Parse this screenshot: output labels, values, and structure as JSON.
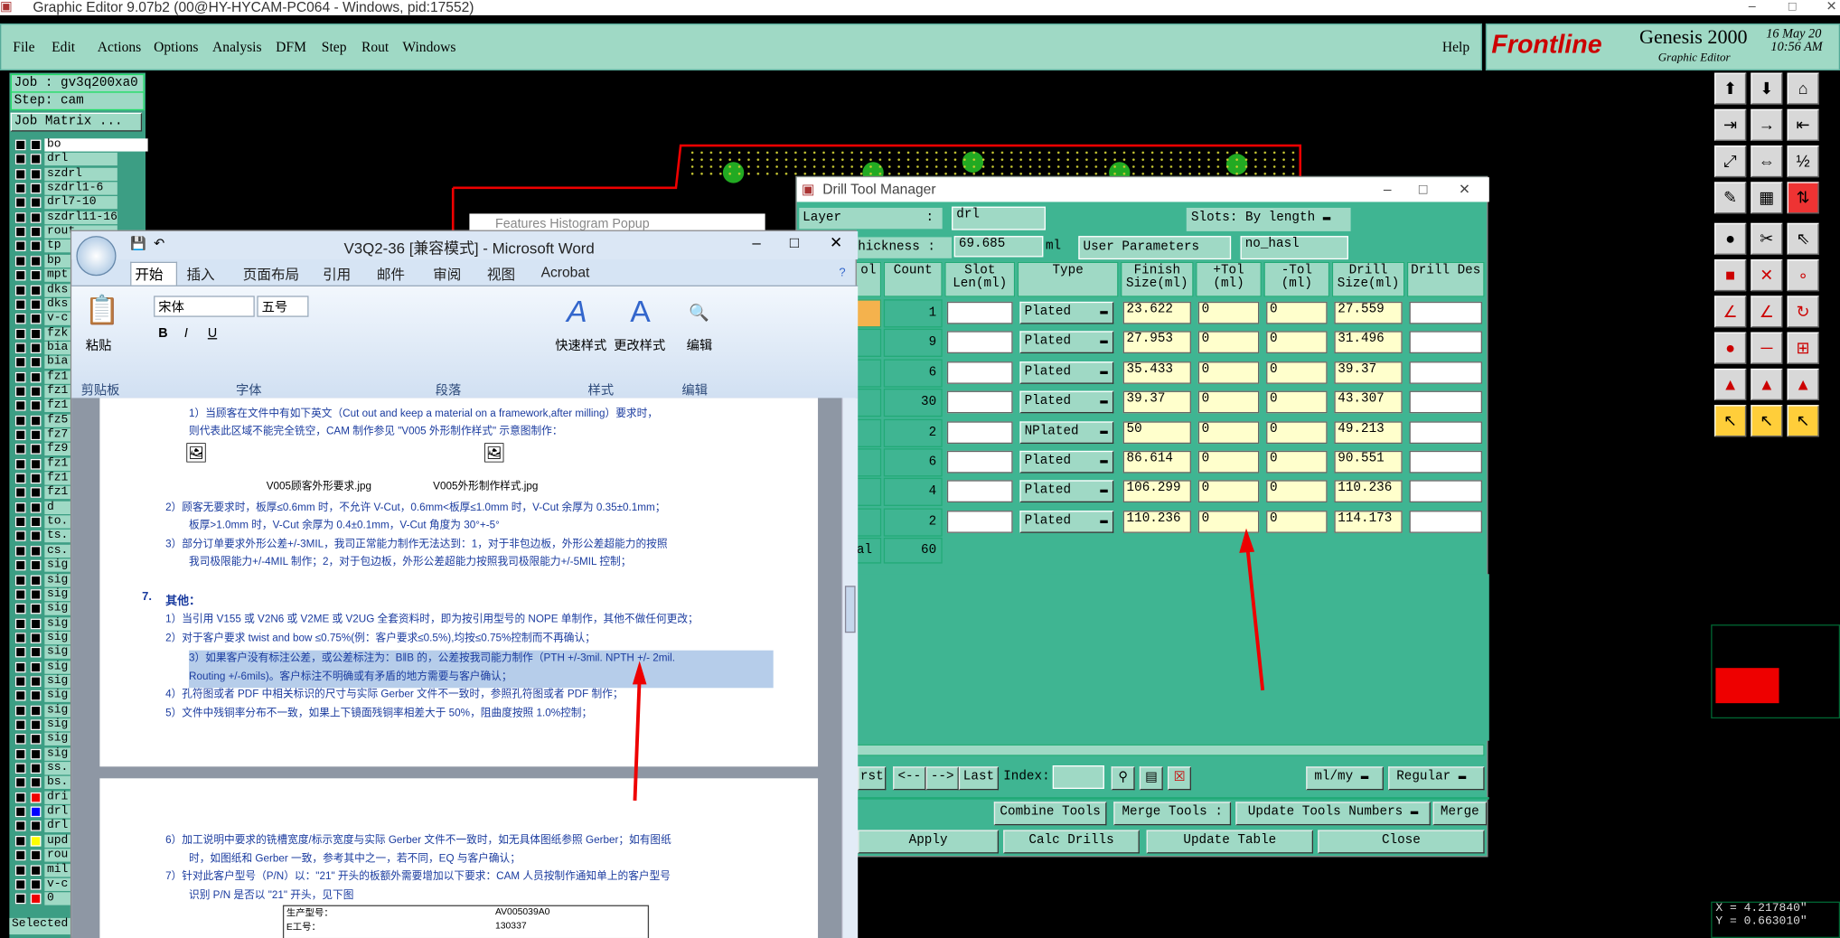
{
  "window": {
    "title": "Graphic Editor 9.07b2 (00@HY-HYCAM-PC064 - Windows, pid:17552)"
  },
  "menu": {
    "items": [
      "File",
      "Edit",
      "Actions",
      "Options",
      "Analysis",
      "DFM",
      "Step",
      "Rout",
      "Windows"
    ],
    "help": "Help"
  },
  "brand": {
    "logo": "Frontline",
    "product": "Genesis 2000",
    "sub": "Graphic Editor",
    "date": "16 May 20",
    "time": "10:56 AM"
  },
  "left": {
    "job": "Job : gv3q200xa0",
    "step": "Step: cam",
    "matrix": "Job Matrix ...",
    "layers": [
      "bo",
      "drl",
      "szdrl",
      "szdrl1-6",
      "drl7-10",
      "szdrl11-16",
      "rout",
      "tp",
      "bp",
      "mpt",
      "dks",
      "dks",
      "v-c",
      "fzk",
      "bia",
      "bia",
      "fz1",
      "fz1",
      "fz1",
      "fz5",
      "fz7",
      "fz9",
      "fz1",
      "fz1",
      "fz1",
      "d",
      "to.",
      "ts.",
      "cs.",
      "sig",
      "sig",
      "sig",
      "sig",
      "sig",
      "sig",
      "sig",
      "sig",
      "sig",
      "sig",
      "sig",
      "sig",
      "sig",
      "sig",
      "ss.",
      "bs.",
      "dri",
      "drl",
      "drl",
      "upd",
      "rou",
      "mil",
      "v-c",
      "0"
    ],
    "selected": "Selected"
  },
  "coords": {
    "x": "X = 4.217840\"",
    "y": "Y = 0.663010\""
  },
  "histogram": {
    "title": "Features Histogram Popup"
  },
  "dtm": {
    "title": "Drill Tool Manager",
    "layer_label": "Layer",
    "layer_value": "drl",
    "slots_label": "Slots:",
    "slots_value": "By length",
    "thickness_label": "hickness :",
    "thickness_value": "69.685",
    "thickness_unit": "ml",
    "user_params_label": "User Parameters",
    "user_params_value": "no_hasl",
    "headers": [
      "ol",
      "Count",
      "Slot Len(ml)",
      "Type",
      "Finish Size(ml)",
      "+Tol (ml)",
      "-Tol (ml)",
      "Drill Size(ml)",
      "Drill Des"
    ],
    "rows": [
      {
        "count": "1",
        "type": "Plated",
        "finish": "23.622",
        "ptol": "0",
        "ntol": "0",
        "drill": "27.559"
      },
      {
        "count": "9",
        "type": "Plated",
        "finish": "27.953",
        "ptol": "0",
        "ntol": "0",
        "drill": "31.496"
      },
      {
        "count": "6",
        "type": "Plated",
        "finish": "35.433",
        "ptol": "0",
        "ntol": "0",
        "drill": "39.37"
      },
      {
        "count": "30",
        "type": "Plated",
        "finish": "39.37",
        "ptol": "0",
        "ntol": "0",
        "drill": "43.307"
      },
      {
        "count": "2",
        "type": "NPlated",
        "finish": "50",
        "ptol": "0",
        "ntol": "0",
        "drill": "49.213"
      },
      {
        "count": "6",
        "type": "Plated",
        "finish": "86.614",
        "ptol": "0",
        "ntol": "0",
        "drill": "90.551"
      },
      {
        "count": "4",
        "type": "Plated",
        "finish": "106.299",
        "ptol": "0",
        "ntol": "0",
        "drill": "110.236"
      },
      {
        "count": "2",
        "type": "Plated",
        "finish": "110.236",
        "ptol": "0",
        "ntol": "0",
        "drill": "114.173"
      }
    ],
    "total_label": "al",
    "total_count": "60",
    "nav": [
      "rst",
      "<--",
      "-->",
      "Last"
    ],
    "index_label": "Index:",
    "units": "ml/my",
    "mode": "Regular",
    "combine": "Combine Tools",
    "merge": "Merge Tools :",
    "update_num": "Update Tools Numbers",
    "merge_btn": "Merge",
    "apply": "Apply",
    "calc": "Calc Drills",
    "update_table": "Update Table",
    "close": "Close"
  },
  "word": {
    "title": "V3Q2-36 [兼容模式] - Microsoft Word",
    "tabs": [
      "开始",
      "插入",
      "页面布局",
      "引用",
      "邮件",
      "审阅",
      "视图",
      "Acrobat"
    ],
    "groups": [
      "剪贴板",
      "字体",
      "段落",
      "样式",
      "编辑"
    ],
    "font": "宋体",
    "size": "五号",
    "paste": "粘贴",
    "quick_style": "快速样式",
    "change_style": "更改样式",
    "edit": "编辑",
    "lines": [
      "1）当顾客在文件中有如下英文（Cut out and keep a material on a framework,after milling）要求时，",
      "则代表此区域不能完全铣空，CAM 制作参见 \"V005 外形制作样式\" 示意图制作：",
      "V005顾客外形要求.jpg",
      "V005外形制作样式.jpg",
      "2）顾客无要求时，板厚≤0.6mm 时，不允许 V-Cut，0.6mm<板厚≤1.0mm 时，V-Cut 余厚为 0.35±0.1mm；",
      "板厚>1.0mm 时，V-Cut 余厚为 0.4±0.1mm，V-Cut 角度为 30°+-5°",
      "3）部分订单要求外形公差+/-3MIL，我司正常能力制作无法达到：1，对于非包边板，外形公差超能力的按照",
      "我司极限能力+/-4MIL 制作；2，对于包边板，外形公差超能力按照我司极限能力+/-5MIL 控制；",
      "7.",
      "其他：",
      "1）当引用 V155 或 V2N6 或 V2ME 或 V2UG 全套资料时，即为按引用型号的 NOPE 单制作，其他不做任何更改；",
      "2）对于客户要求 twist and bow ≤0.75%(例：客户要求≤0.5%),均按≤0.75%控制而不再确认；",
      "3）如果客户没有标注公差，或公差标注为：B‖B 的，公差按我司能力制作（PTH +/-3mil. NPTH +/- 2mil.",
      "Routing +/-6mils)。客户标注不明确或有矛盾的地方需要与客户确认；",
      "4）孔符图或者 PDF 中相关标识的尺寸与实际 Gerber 文件不一致时，参照孔符图或者 PDF 制作；",
      "5）文件中残铜率分布不一致，如果上下镜面残铜率相差大于 50%，阻曲度按照 1.0%控制；",
      "6）加工说明中要求的铣槽宽度/标示宽度与实际 Gerber 文件不一致时，如无具体图纸参照 Gerber；如有图纸",
      "时，如图纸和 Gerber 一致，参考其中之一，若不同，EQ 与客户确认；",
      "7）针对此客户型号（P/N）以：\"21\" 开头的板额外需要增加以下要求：CAM 人员按制作通知单上的客户型号",
      "识别 P/N 是否以 \"21\" 开头，见下图"
    ],
    "table": [
      [
        "生产型号：",
        "AV005039A0"
      ],
      [
        "E工号：",
        "130337"
      ]
    ]
  }
}
